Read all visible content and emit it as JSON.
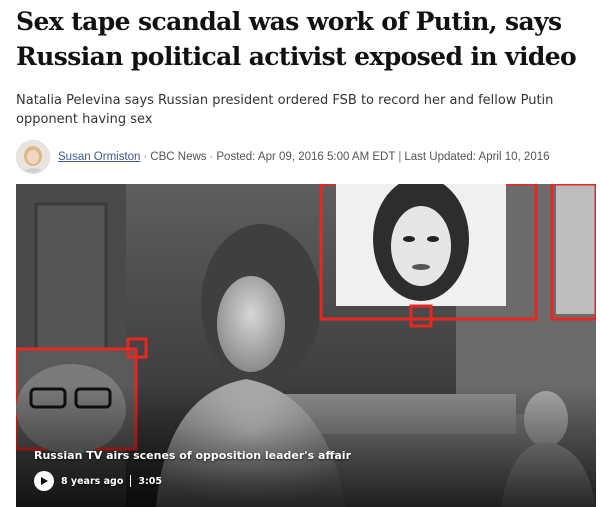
{
  "article": {
    "headline": "Sex tape scandal was work of Putin, says Russian political activist exposed in video",
    "subhead": "Natalia Pelevina says Russian president ordered FSB to record her and fellow Putin opponent having sex",
    "byline": {
      "author": "Susan Ormiston",
      "source": "CBC News",
      "posted": "Posted: Apr 09, 2016 5:00 AM EDT",
      "divider": "|",
      "updated": "Last Updated: April 10, 2016",
      "dot": "·"
    }
  },
  "video": {
    "title": "Russian TV airs scenes of opposition leader's affair",
    "age": "8 years ago",
    "duration": "3:05",
    "accent_color": "#e8271f",
    "play_icon": "play-icon"
  },
  "colors": {
    "author_link": "#3b5b96",
    "headline": "#111111",
    "subhead": "#333333"
  }
}
